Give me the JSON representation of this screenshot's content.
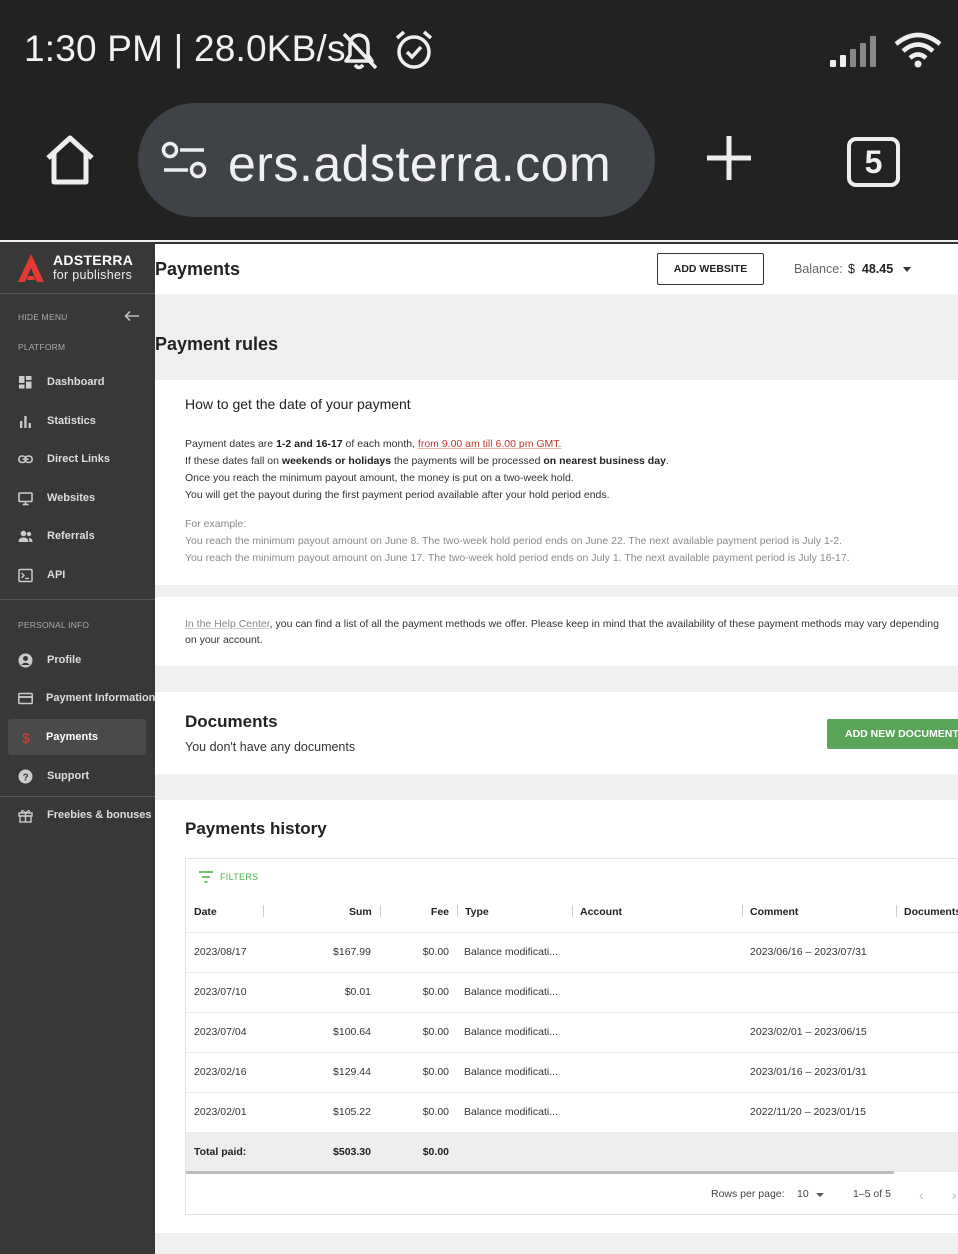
{
  "status_bar": {
    "time_speed": "1:30 PM | 28.0KB/s"
  },
  "browser": {
    "url": "ers.adsterra.com",
    "tab_count": "5"
  },
  "sidebar": {
    "brand": "ADSTERRA",
    "brand_sub": "for publishers",
    "hide_menu": "HIDE MENU",
    "section_platform": "PLATFORM",
    "platform_items": [
      {
        "label": "Dashboard",
        "icon": "dashboard-icon"
      },
      {
        "label": "Statistics",
        "icon": "bar-chart-icon"
      },
      {
        "label": "Direct Links",
        "icon": "link-icon"
      },
      {
        "label": "Websites",
        "icon": "monitor-icon"
      },
      {
        "label": "Referrals",
        "icon": "people-icon"
      },
      {
        "label": "API",
        "icon": "terminal-icon"
      }
    ],
    "section_personal": "PERSONAL INFO",
    "personal_items": [
      {
        "label": "Profile",
        "icon": "profile-icon"
      },
      {
        "label": "Payment Information",
        "icon": "card-icon"
      },
      {
        "label": "Payments",
        "icon": "dollar-icon",
        "active": true
      },
      {
        "label": "Support",
        "icon": "help-icon"
      },
      {
        "label": "Freebies & bonuses",
        "icon": "gift-icon"
      }
    ]
  },
  "header": {
    "title": "Payments",
    "add_website": "ADD WEBSITE",
    "balance_label": "Balance:",
    "balance_currency": "$",
    "balance_value": "48.45"
  },
  "payment_rules": {
    "heading": "Payment rules",
    "card_title": "How to get the date of your payment",
    "l1_a": "Payment dates are ",
    "l1_b": "1-2 and 16-17",
    "l1_c": " of each month, ",
    "l1_d": "from 9.00 am till 6.00 pm GMT",
    "l1_e": ".",
    "l2_a": "If these dates fall on ",
    "l2_b": "weekends or holidays",
    "l2_c": " the payments will be processed ",
    "l2_d": "on nearest business day",
    "l2_e": ".",
    "l3": "Once you reach the minimum payout amount, the money is put on a two-week hold.",
    "l4": "You will get the payout during the first payment period available after your hold period ends.",
    "ex_label": "For example:",
    "ex1": "You reach the minimum payout amount on June 8. The two-week hold period ends on June 22. The next available payment period is July 1-2.",
    "ex2": "You reach the minimum payout amount on June 17. The two-week hold period ends on July 1. The next available payment period is July 16-17."
  },
  "methods_note": {
    "link": "In the Help Center",
    "rest": ", you can find a list of all the payment methods we offer. Please keep in mind that the availability of these payment methods may vary depending",
    "line2": "on your account."
  },
  "documents": {
    "title": "Documents",
    "empty": "You don't have any documents",
    "add_button": "ADD NEW DOCUMENT"
  },
  "history": {
    "title": "Payments history",
    "filters": "FILTERS",
    "columns": [
      "Date",
      "Sum",
      "Fee",
      "Type",
      "Account",
      "Comment",
      "Documents"
    ],
    "rows": [
      {
        "date": "2023/08/17",
        "sum": "$167.99",
        "fee": "$0.00",
        "type": "Balance modificati...",
        "account": "",
        "comment": "2023/06/16 – 2023/07/31"
      },
      {
        "date": "2023/07/10",
        "sum": "$0.01",
        "fee": "$0.00",
        "type": "Balance modificati...",
        "account": "",
        "comment": ""
      },
      {
        "date": "2023/07/04",
        "sum": "$100.64",
        "fee": "$0.00",
        "type": "Balance modificati...",
        "account": "",
        "comment": "2023/02/01 – 2023/06/15"
      },
      {
        "date": "2023/02/16",
        "sum": "$129.44",
        "fee": "$0.00",
        "type": "Balance modificati...",
        "account": "",
        "comment": "2023/01/16 – 2023/01/31"
      },
      {
        "date": "2023/02/01",
        "sum": "$105.22",
        "fee": "$0.00",
        "type": "Balance modificati...",
        "account": "",
        "comment": "2022/11/20 – 2023/01/15"
      }
    ],
    "total_label": "Total paid:",
    "total_sum": "$503.30",
    "total_fee": "$0.00",
    "rows_per_page_label": "Rows per page:",
    "rows_per_page": "10",
    "range": "1–5 of 5"
  },
  "colors": {
    "accent_green": "#5aa55a",
    "brand_red": "#e53935",
    "sidebar_bg": "#383838",
    "link_red": "#c0392b"
  }
}
